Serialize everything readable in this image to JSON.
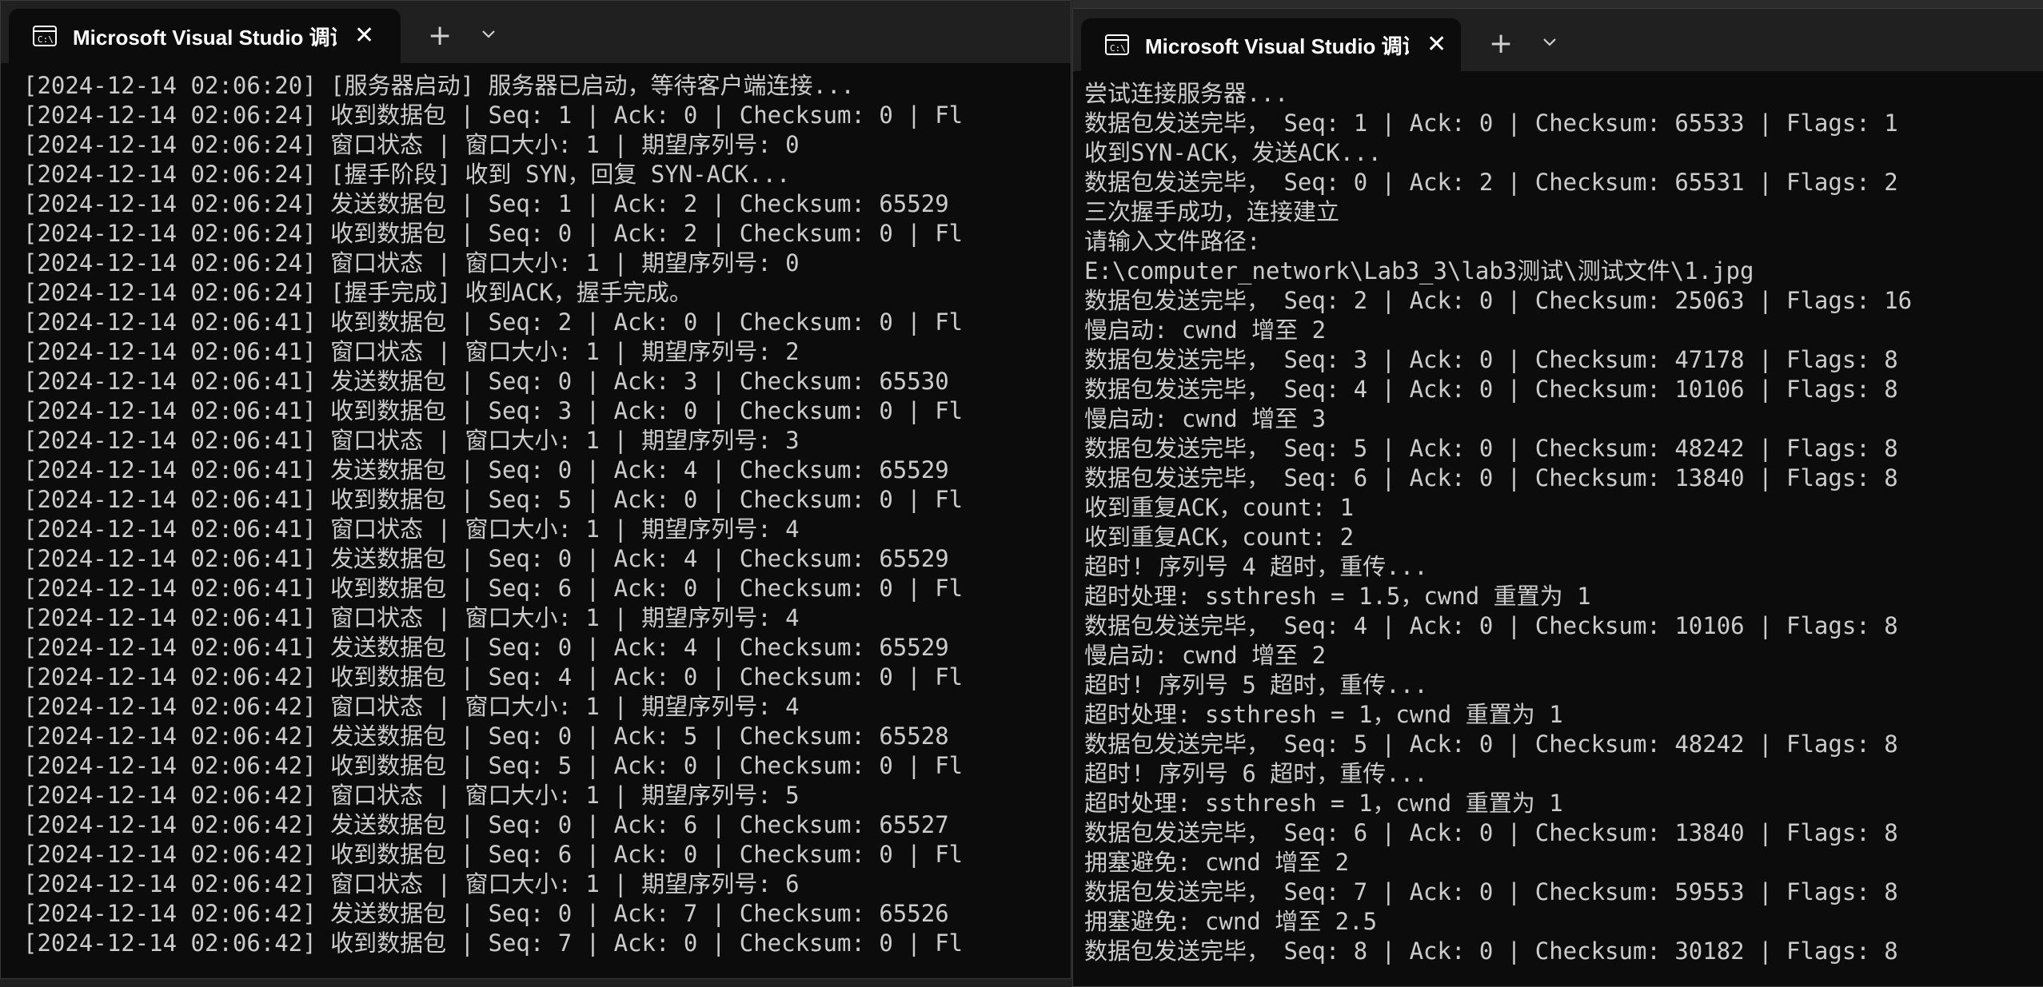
{
  "left_window": {
    "tab_title": "Microsoft Visual Studio 调试控制台",
    "tab_icon": "console-app-icon",
    "lines": [
      "[2024-12-14 02:06:20] [服务器启动] 服务器已启动，等待客户端连接...",
      "[2024-12-14 02:06:24] 收到数据包 | Seq: 1 | Ack: 0 | Checksum: 0 | Fl",
      "[2024-12-14 02:06:24] 窗口状态 | 窗口大小: 1 | 期望序列号: 0",
      "[2024-12-14 02:06:24] [握手阶段] 收到 SYN，回复 SYN-ACK...",
      "[2024-12-14 02:06:24] 发送数据包 | Seq: 1 | Ack: 2 | Checksum: 65529",
      "[2024-12-14 02:06:24] 收到数据包 | Seq: 0 | Ack: 2 | Checksum: 0 | Fl",
      "[2024-12-14 02:06:24] 窗口状态 | 窗口大小: 1 | 期望序列号: 0",
      "[2024-12-14 02:06:24] [握手完成] 收到ACK，握手完成。",
      "[2024-12-14 02:06:41] 收到数据包 | Seq: 2 | Ack: 0 | Checksum: 0 | Fl",
      "[2024-12-14 02:06:41] 窗口状态 | 窗口大小: 1 | 期望序列号: 2",
      "[2024-12-14 02:06:41] 发送数据包 | Seq: 0 | Ack: 3 | Checksum: 65530",
      "[2024-12-14 02:06:41] 收到数据包 | Seq: 3 | Ack: 0 | Checksum: 0 | Fl",
      "[2024-12-14 02:06:41] 窗口状态 | 窗口大小: 1 | 期望序列号: 3",
      "[2024-12-14 02:06:41] 发送数据包 | Seq: 0 | Ack: 4 | Checksum: 65529",
      "[2024-12-14 02:06:41] 收到数据包 | Seq: 5 | Ack: 0 | Checksum: 0 | Fl",
      "[2024-12-14 02:06:41] 窗口状态 | 窗口大小: 1 | 期望序列号: 4",
      "[2024-12-14 02:06:41] 发送数据包 | Seq: 0 | Ack: 4 | Checksum: 65529",
      "[2024-12-14 02:06:41] 收到数据包 | Seq: 6 | Ack: 0 | Checksum: 0 | Fl",
      "[2024-12-14 02:06:41] 窗口状态 | 窗口大小: 1 | 期望序列号: 4",
      "[2024-12-14 02:06:41] 发送数据包 | Seq: 0 | Ack: 4 | Checksum: 65529",
      "[2024-12-14 02:06:42] 收到数据包 | Seq: 4 | Ack: 0 | Checksum: 0 | Fl",
      "[2024-12-14 02:06:42] 窗口状态 | 窗口大小: 1 | 期望序列号: 4",
      "[2024-12-14 02:06:42] 发送数据包 | Seq: 0 | Ack: 5 | Checksum: 65528",
      "[2024-12-14 02:06:42] 收到数据包 | Seq: 5 | Ack: 0 | Checksum: 0 | Fl",
      "[2024-12-14 02:06:42] 窗口状态 | 窗口大小: 1 | 期望序列号: 5",
      "[2024-12-14 02:06:42] 发送数据包 | Seq: 0 | Ack: 6 | Checksum: 65527",
      "[2024-12-14 02:06:42] 收到数据包 | Seq: 6 | Ack: 0 | Checksum: 0 | Fl",
      "[2024-12-14 02:06:42] 窗口状态 | 窗口大小: 1 | 期望序列号: 6",
      "[2024-12-14 02:06:42] 发送数据包 | Seq: 0 | Ack: 7 | Checksum: 65526",
      "[2024-12-14 02:06:42] 收到数据包 | Seq: 7 | Ack: 0 | Checksum: 0 | Fl"
    ]
  },
  "right_window": {
    "tab_title": "Microsoft Visual Studio 调试控制台",
    "tab_icon": "console-app-icon",
    "lines": [
      "尝试连接服务器...",
      "数据包发送完毕， Seq: 1 | Ack: 0 | Checksum: 65533 | Flags: 1",
      "收到SYN-ACK，发送ACK...",
      "数据包发送完毕， Seq: 0 | Ack: 2 | Checksum: 65531 | Flags: 2",
      "三次握手成功，连接建立",
      "请输入文件路径:",
      "E:\\computer_network\\Lab3_3\\lab3测试\\测试文件\\1.jpg",
      "数据包发送完毕， Seq: 2 | Ack: 0 | Checksum: 25063 | Flags: 16",
      "慢启动: cwnd 增至 2",
      "数据包发送完毕， Seq: 3 | Ack: 0 | Checksum: 47178 | Flags: 8",
      "数据包发送完毕， Seq: 4 | Ack: 0 | Checksum: 10106 | Flags: 8",
      "慢启动: cwnd 增至 3",
      "数据包发送完毕， Seq: 5 | Ack: 0 | Checksum: 48242 | Flags: 8",
      "数据包发送完毕， Seq: 6 | Ack: 0 | Checksum: 13840 | Flags: 8",
      "收到重复ACK，count: 1",
      "收到重复ACK，count: 2",
      "超时! 序列号 4 超时，重传...",
      "超时处理: ssthresh = 1.5，cwnd 重置为 1",
      "数据包发送完毕， Seq: 4 | Ack: 0 | Checksum: 10106 | Flags: 8",
      "慢启动: cwnd 增至 2",
      "超时! 序列号 5 超时，重传...",
      "超时处理: ssthresh = 1，cwnd 重置为 1",
      "数据包发送完毕， Seq: 5 | Ack: 0 | Checksum: 48242 | Flags: 8",
      "超时! 序列号 6 超时，重传...",
      "超时处理: ssthresh = 1，cwnd 重置为 1",
      "数据包发送完毕， Seq: 6 | Ack: 0 | Checksum: 13840 | Flags: 8",
      "拥塞避免: cwnd 增至 2",
      "数据包发送完毕， Seq: 7 | Ack: 0 | Checksum: 59553 | Flags: 8",
      "拥塞避免: cwnd 增至 2.5",
      "数据包发送完毕， Seq: 8 | Ack: 0 | Checksum: 30182 | Flags: 8"
    ]
  },
  "colors": {
    "console_bg": "#0c0c0c",
    "console_text": "#cccccc",
    "titlebar_bg": "#202020",
    "tab_text": "#ffffff"
  }
}
